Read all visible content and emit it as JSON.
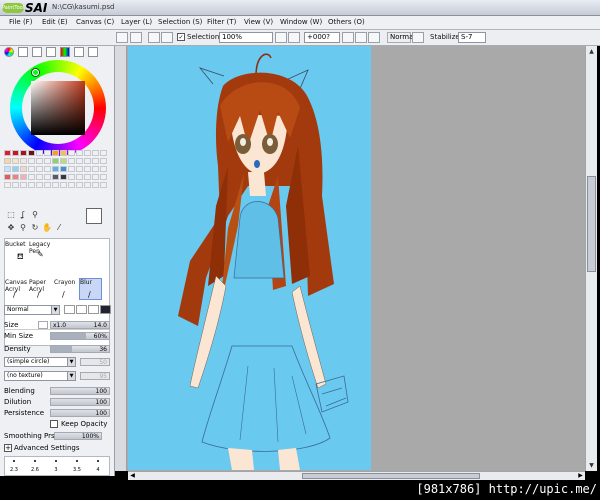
{
  "window": {
    "logo_text": "PaintTool",
    "logo_brand": "SAI",
    "file_path": "N:\\CG\\kasumi.psd"
  },
  "menu": {
    "items": [
      {
        "label": "File (F)"
      },
      {
        "label": "Edit (E)"
      },
      {
        "label": "Canvas (C)"
      },
      {
        "label": "Layer (L)"
      },
      {
        "label": "Selection (S)"
      },
      {
        "label": "Filter (T)"
      },
      {
        "label": "View (V)"
      },
      {
        "label": "Window (W)"
      },
      {
        "label": "Others (O)"
      }
    ]
  },
  "toolbar": {
    "selection_label": "Selection",
    "selection_checked": true,
    "zoom_value": "100%",
    "rotation_value": "+000?",
    "blend_value": "Normal",
    "stabilizer_label": "Stabilizer",
    "stabilizer_value": "S-7"
  },
  "colors": {
    "swatch_rows": [
      [
        "#e11b2a",
        "#c8151f",
        "#a3131a",
        "#6f0f12",
        "#eef0f3",
        "#eef0f3",
        "#f7a01a",
        "#f5c04a",
        "#eef0f3",
        "#eef0f3",
        "#eef0f3",
        "#eef0f3",
        "#eef0f3"
      ],
      [
        "#f7d6a8",
        "#f9e4c0",
        "#f0e9d8",
        "#eef0f3",
        "#eef0f3",
        "#eef0f3",
        "#8ed26b",
        "#b6e07a",
        "#eef0f3",
        "#eef0f3",
        "#eef0f3",
        "#eef0f3",
        "#eef0f3"
      ],
      [
        "#bfe6f8",
        "#8fd2f2",
        "#f2d9c4",
        "#eef0f3",
        "#eef0f3",
        "#eef0f3",
        "#5bb0e6",
        "#3f8fd6",
        "#eef0f3",
        "#eef0f3",
        "#eef0f3",
        "#eef0f3",
        "#eef0f3"
      ],
      [
        "#e85a5a",
        "#f08080",
        "#f4b0b0",
        "#eef0f3",
        "#eef0f3",
        "#eef0f3",
        "#555a66",
        "#333844",
        "#eef0f3",
        "#eef0f3",
        "#eef0f3",
        "#eef0f3",
        "#eef0f3"
      ],
      [
        "#f8f0e8",
        "#eef0f3",
        "#eef0f3",
        "#eef0f3",
        "#eef0f3",
        "#eef0f3",
        "#eef0f3",
        "#eef0f3",
        "#eef0f3",
        "#eef0f3",
        "#eef0f3",
        "#eef0f3",
        "#eef0f3"
      ]
    ]
  },
  "brushes": [
    {
      "label": "Bucket",
      "icon": "bucket-icon",
      "selected": false
    },
    {
      "label": "Legacy Pen",
      "icon": "pen-icon",
      "selected": false
    },
    {
      "label": "",
      "icon": "",
      "selected": false
    },
    {
      "label": "",
      "icon": "",
      "selected": false
    },
    {
      "label": "Canvas Acryl",
      "icon": "brush-icon",
      "selected": false
    },
    {
      "label": "Paper Acryl",
      "icon": "brush-icon",
      "selected": false
    },
    {
      "label": "Crayon",
      "icon": "brush-icon",
      "selected": false
    },
    {
      "label": "Blur",
      "icon": "brush-icon",
      "selected": true
    }
  ],
  "brush_settings": {
    "mode": "Normal",
    "size_label": "Size",
    "size_multiplier": "x1.0",
    "size_value": "14.0",
    "min_size_label": "Min Size",
    "min_size_value": "60%",
    "min_size_fraction": 0.6,
    "density_label": "Density",
    "density_value": "36",
    "density_fraction": 0.36,
    "shape_option": "(simple circle)",
    "shape_value": "50",
    "texture_option": "(no texture)",
    "texture_value": "95",
    "blending_label": "Blending",
    "blending_value": "100",
    "dilution_label": "Dilution",
    "dilution_value": "100",
    "persistence_label": "Persistence",
    "persistence_value": "100",
    "keep_opacity_label": "Keep Opacity",
    "smoothing_label": "Smoothing Prs",
    "smoothing_value": "100%",
    "advanced_label": "Advanced Settings",
    "size_presets": [
      "2.3",
      "2.6",
      "3",
      "3.5",
      "4"
    ]
  },
  "watermark": "[981x786] http://upic.me/"
}
